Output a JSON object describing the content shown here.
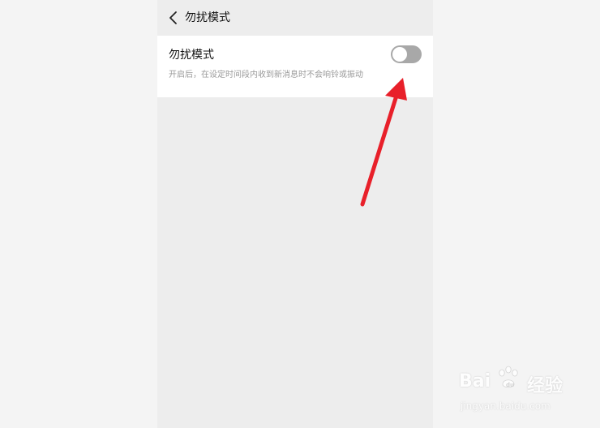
{
  "header": {
    "title": "勿扰模式",
    "back_icon": "chevron-left-icon"
  },
  "setting": {
    "name": "勿扰模式",
    "description": "开启后，在设定时间段内收到新消息时不会响铃或振动",
    "toggle_state": "off"
  },
  "watermark": {
    "logo": "Bai",
    "logo_suffix": "du",
    "name": "经验",
    "url": "jingyan.baidu.com"
  },
  "colors": {
    "arrow": "#e8202a",
    "toggle_off": "#a8a8a8",
    "page_bg": "#ededed",
    "card_bg": "#ffffff"
  }
}
